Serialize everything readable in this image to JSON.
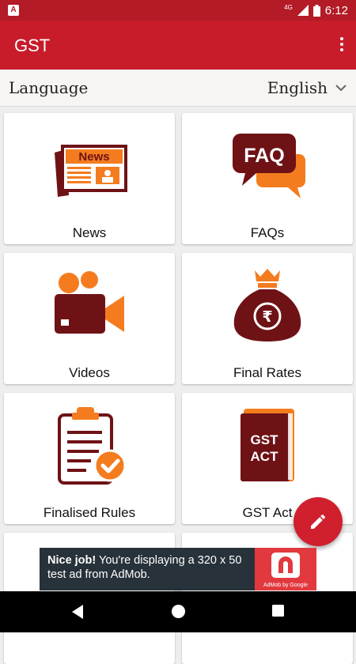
{
  "status_bar": {
    "app_badge": "A",
    "network": "4G",
    "time": "6:12"
  },
  "app_bar": {
    "title": "GST",
    "menu_icon": "more-vert-icon"
  },
  "language": {
    "label": "Language",
    "selected": "English"
  },
  "tiles": [
    {
      "id": "news",
      "label": "News",
      "icon": "newspaper-icon",
      "icon_text": "News"
    },
    {
      "id": "faqs",
      "label": "FAQs",
      "icon": "faq-chat-icon",
      "icon_text": "FAQ"
    },
    {
      "id": "videos",
      "label": "Videos",
      "icon": "video-camera-icon"
    },
    {
      "id": "final-rates",
      "label": "Final Rates",
      "icon": "rupee-bag-icon",
      "icon_text": "₹"
    },
    {
      "id": "finalised-rules",
      "label": "Finalised Rules",
      "icon": "clipboard-check-icon"
    },
    {
      "id": "gst-act",
      "label": "GST Act",
      "icon": "book-icon",
      "icon_text": [
        "GST",
        "ACT"
      ]
    }
  ],
  "fab": {
    "icon": "pencil-icon"
  },
  "ad": {
    "headline": "Nice job!",
    "body": " You're displaying a 320 x 50 test ad from AdMob.",
    "attribution": "AdMob by Google"
  },
  "colors": {
    "primary": "#c81c2b",
    "accent": "#f47c1f",
    "dark_red": "#6e1216"
  }
}
